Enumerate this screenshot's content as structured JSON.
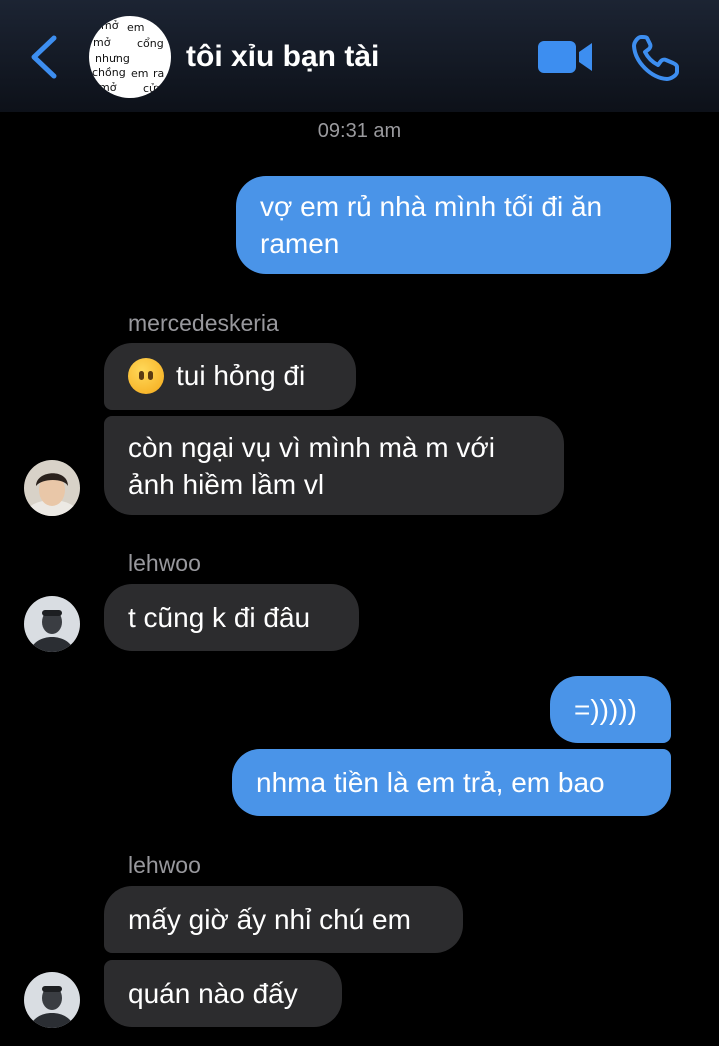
{
  "header": {
    "title": "tôi xỉu bạn tài",
    "avatar_words": [
      "mở",
      "em",
      "mở",
      "cổng",
      "nhưng",
      "chồng",
      "em",
      "ra",
      "mở",
      "cửa"
    ],
    "icons": {
      "back": "chevron-left-icon",
      "video": "video-camera-icon",
      "call": "phone-icon"
    },
    "accent_color": "#4a94e8"
  },
  "timestamp": "09:31 am",
  "messages": [
    {
      "from": "me",
      "text_lines": [
        "vợ em rủ nhà mình tối đi ăn",
        "ramen"
      ]
    },
    {
      "from": "mercedeskeria",
      "sender_label": "mercedeskeria",
      "emoji": "face-without-mouth",
      "text": "tui hỏng đi"
    },
    {
      "from": "mercedeskeria",
      "text_lines": [
        "còn ngại vụ vì mình mà m với",
        "ảnh hiềm lầm vl"
      ]
    },
    {
      "from": "lehwoo",
      "sender_label": "lehwoo",
      "text": "t cũng k đi đâu"
    },
    {
      "from": "me",
      "text": "=)))))"
    },
    {
      "from": "me",
      "text": "nhma tiền là em trả, em bao"
    },
    {
      "from": "lehwoo",
      "sender_label": "lehwoo",
      "text": "mấy giờ ấy nhỉ chú em"
    },
    {
      "from": "lehwoo",
      "text": "quán nào đấy"
    }
  ],
  "colors": {
    "incoming_bubble": "#2c2c2e",
    "outgoing_bubble": "#4a94e8",
    "background": "#000000"
  }
}
